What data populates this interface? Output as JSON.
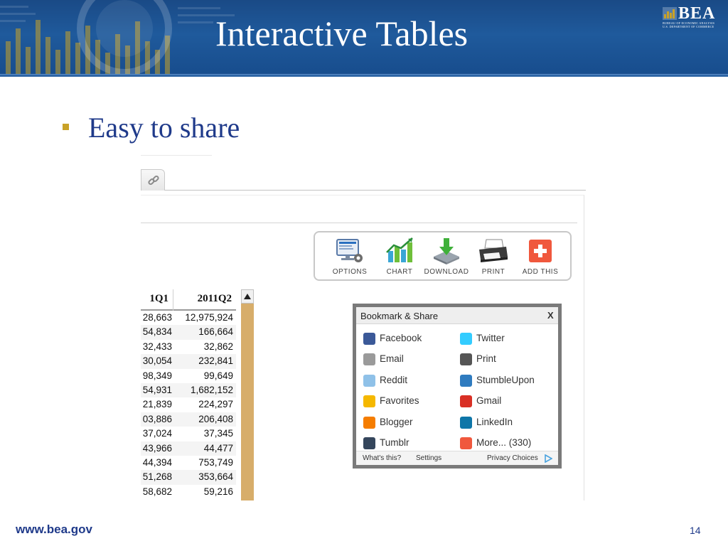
{
  "slide": {
    "title": "Interactive Tables",
    "bullet": "Easy to share",
    "footer_url": "www.bea.gov",
    "page_number": "14",
    "logo_text": "BEA",
    "logo_sub1": "BUREAU OF ECONOMIC ANALYSIS",
    "logo_sub2": "U.S. DEPARTMENT OF COMMERCE"
  },
  "toolbar": {
    "items": [
      {
        "label": "OPTIONS",
        "icon": "options-icon"
      },
      {
        "label": "CHART",
        "icon": "chart-icon"
      },
      {
        "label": "DOWNLOAD",
        "icon": "download-icon"
      },
      {
        "label": "PRINT",
        "icon": "print-icon"
      },
      {
        "label": "ADD THIS",
        "icon": "add-this-icon"
      }
    ]
  },
  "table": {
    "headers": [
      "1Q1",
      "2011Q2"
    ],
    "rows": [
      [
        "28,663",
        "12,975,924"
      ],
      [
        "54,834",
        "166,664"
      ],
      [
        "32,433",
        "32,862"
      ],
      [
        "30,054",
        "232,841"
      ],
      [
        "98,349",
        "99,649"
      ],
      [
        "54,931",
        "1,682,152"
      ],
      [
        "21,839",
        "224,297"
      ],
      [
        "03,886",
        "206,408"
      ],
      [
        "37,024",
        "37,345"
      ],
      [
        "43,966",
        "44,477"
      ],
      [
        "44,394",
        "753,749"
      ],
      [
        "51,268",
        "353,664"
      ],
      [
        "58,682",
        "59,216"
      ]
    ]
  },
  "share": {
    "title": "Bookmark & Share",
    "close": "X",
    "services": [
      {
        "name": "Facebook",
        "icon": "facebook-icon",
        "color": "#3b5998"
      },
      {
        "name": "Twitter",
        "icon": "twitter-icon",
        "color": "#33ccff"
      },
      {
        "name": "Email",
        "icon": "email-icon",
        "color": "#9a9a9a"
      },
      {
        "name": "Print",
        "icon": "print-icon",
        "color": "#555555"
      },
      {
        "name": "Reddit",
        "icon": "reddit-icon",
        "color": "#8fc1e8"
      },
      {
        "name": "StumbleUpon",
        "icon": "stumbleupon-icon",
        "color": "#2f7bbf"
      },
      {
        "name": "Favorites",
        "icon": "favorites-icon",
        "color": "#f5b800"
      },
      {
        "name": "Gmail",
        "icon": "gmail-icon",
        "color": "#d93025"
      },
      {
        "name": "Blogger",
        "icon": "blogger-icon",
        "color": "#f57d00"
      },
      {
        "name": "LinkedIn",
        "icon": "linkedin-icon",
        "color": "#0e76a8"
      },
      {
        "name": "Tumblr",
        "icon": "tumblr-icon",
        "color": "#35465c"
      },
      {
        "name": "More... (330)",
        "icon": "more-icon",
        "color": "#f0583d"
      }
    ],
    "footer": {
      "whats_this": "What's this?",
      "settings": "Settings",
      "privacy": "Privacy Choices"
    }
  },
  "colors": {
    "banner": "#1f5a9c",
    "bullet_text": "#1f3a8a",
    "bullet_mark": "#c9a227",
    "scrollbar": "#d7ad6a"
  }
}
